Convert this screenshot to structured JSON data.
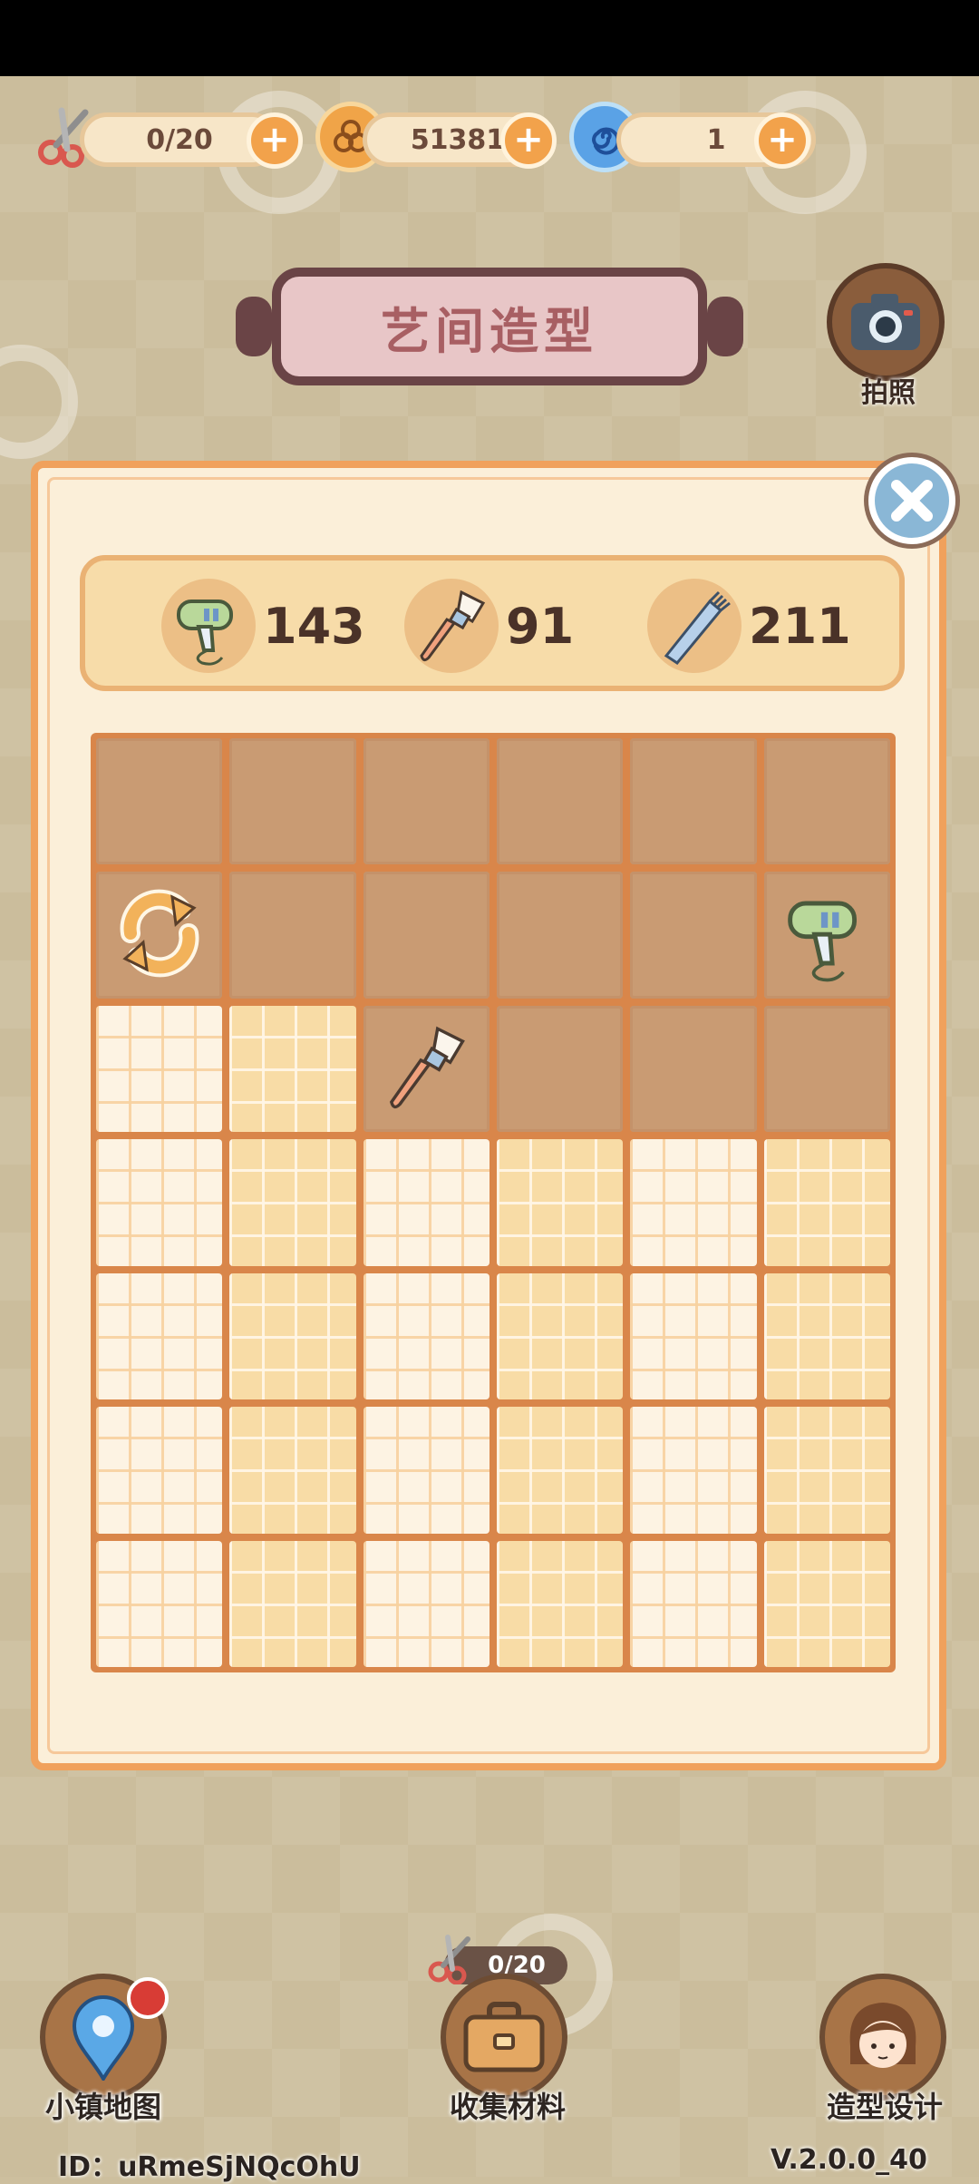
{
  "resources": {
    "scissors_count": "0/20",
    "coins": "51381",
    "spiral": "1"
  },
  "title": "艺间造型",
  "camera_label": "拍照",
  "tools": [
    {
      "icon": "hair-dryer-icon",
      "count": "143"
    },
    {
      "icon": "makeup-brush-icon",
      "count": "91"
    },
    {
      "icon": "comb-icon",
      "count": "211"
    }
  ],
  "grid": {
    "columns": 6,
    "rows": [
      [
        "locked",
        "locked",
        "locked",
        "locked",
        "locked",
        "locked"
      ],
      [
        "locked",
        "locked",
        "locked",
        "locked",
        "locked",
        "locked"
      ],
      [
        "open",
        "open",
        "locked",
        "locked",
        "locked",
        "locked"
      ],
      [
        "open",
        "open",
        "open",
        "open",
        "open",
        "open"
      ],
      [
        "open",
        "open",
        "open",
        "open",
        "open",
        "open"
      ],
      [
        "open",
        "open",
        "open",
        "open",
        "open",
        "open"
      ],
      [
        "open",
        "open",
        "open",
        "open",
        "open",
        "open"
      ]
    ],
    "items": [
      {
        "row": 1,
        "col": 0,
        "icon": "refresh-icon"
      },
      {
        "row": 1,
        "col": 5,
        "icon": "hair-dryer-icon"
      },
      {
        "row": 2,
        "col": 2,
        "icon": "makeup-brush-icon"
      }
    ]
  },
  "nav": {
    "map_label": "小镇地图",
    "collect_label": "收集材料",
    "collect_counter": "0/20",
    "design_label": "造型设计"
  },
  "footer": {
    "id_text": "ID：uRmeSjNQcOhU",
    "version": "V.2.0.0_40"
  },
  "colors": {
    "panel_border": "#f0a15c",
    "locked_cell": "#c99b73",
    "accent_orange": "#f2a24b"
  }
}
